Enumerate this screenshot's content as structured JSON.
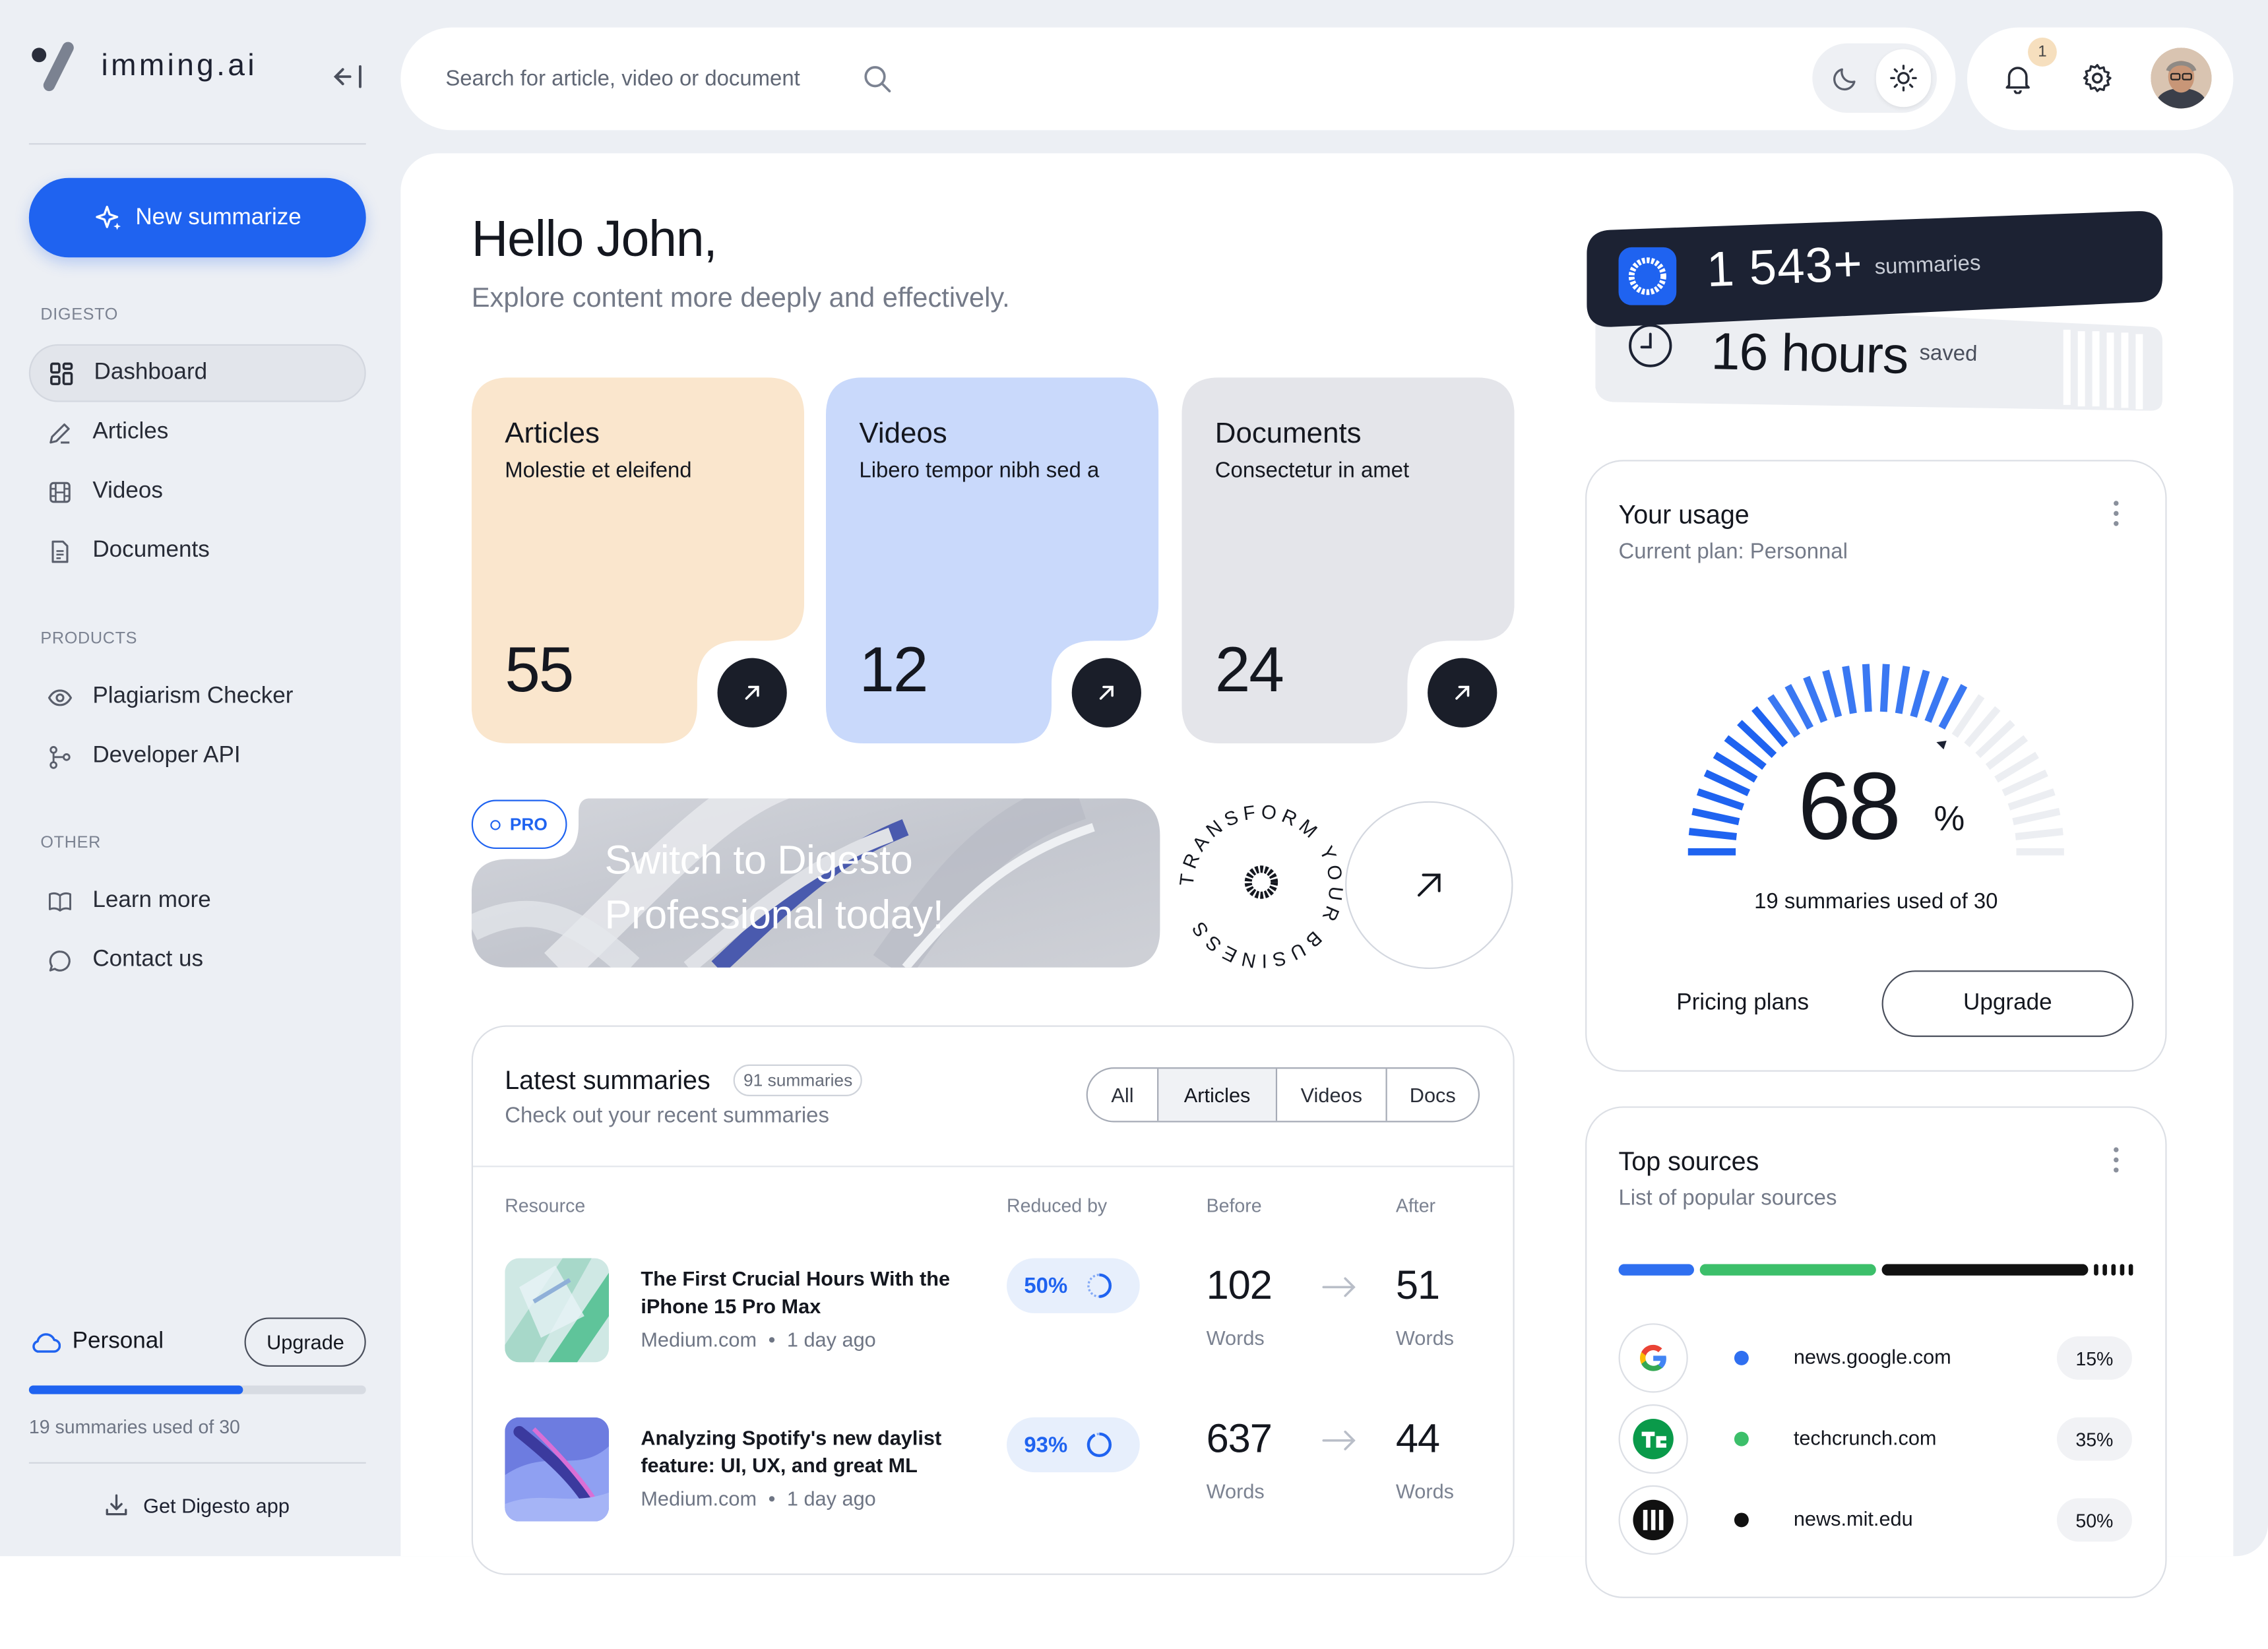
{
  "app": {
    "logo_text": "imming.ai"
  },
  "sidebar": {
    "new_button": "New summarize",
    "sections": [
      {
        "label": "DIGESTO",
        "items": [
          {
            "label": "Dashboard",
            "icon": "grid-icon",
            "active": true
          },
          {
            "label": "Articles",
            "icon": "pen-icon"
          },
          {
            "label": "Videos",
            "icon": "film-icon"
          },
          {
            "label": "Documents",
            "icon": "document-icon"
          }
        ]
      },
      {
        "label": "PRODUCTS",
        "items": [
          {
            "label": "Plagiarism Checker",
            "icon": "eye-icon"
          },
          {
            "label": "Developer API",
            "icon": "branch-icon"
          }
        ]
      },
      {
        "label": "OTHER",
        "items": [
          {
            "label": "Learn more",
            "icon": "book-icon"
          },
          {
            "label": "Contact us",
            "icon": "chat-icon"
          }
        ]
      }
    ],
    "plan": {
      "name": "Personal",
      "upgrade": "Upgrade",
      "usage_text": "19 summaries used of 30",
      "used": 19,
      "total": 30
    },
    "get_app": "Get Digesto app"
  },
  "header": {
    "search_placeholder": "Search for article, video or document",
    "notification_count": "1"
  },
  "greeting": {
    "title": "Hello John,",
    "subtitle": "Explore content more deeply and effectively."
  },
  "cards": [
    {
      "title": "Articles",
      "subtitle": "Molestie et eleifend",
      "count": "55",
      "color": "#fae6cd"
    },
    {
      "title": "Videos",
      "subtitle": "Libero tempor nibh sed a",
      "count": "12",
      "color": "#c9d9fb"
    },
    {
      "title": "Documents",
      "subtitle": "Consectetur in amet",
      "count": "24",
      "color": "#e4e5ea"
    }
  ],
  "promo": {
    "badge": "PRO",
    "line1": "Switch to Digesto",
    "line2": "Professional today!",
    "circle_text": "TRANSFORM YOUR BUSINESS"
  },
  "latest": {
    "title": "Latest summaries",
    "count": "91 summaries",
    "subtitle": "Check out your recent summaries",
    "tabs": [
      "All",
      "Articles",
      "Videos",
      "Docs"
    ],
    "selected_tab": "Articles",
    "columns": {
      "resource": "Resource",
      "reduced": "Reduced by",
      "before": "Before",
      "after": "After"
    },
    "rows": [
      {
        "title": "The First Crucial Hours With the iPhone 15 Pro Max",
        "source": "Medium.com",
        "time": "1 day ago",
        "reduced": "50%",
        "before": "102",
        "after": "51",
        "unit": "Words"
      },
      {
        "title": "Analyzing Spotify's new daylist feature: UI, UX, and great ML",
        "source": "Medium.com",
        "time": "1 day ago",
        "reduced": "93%",
        "before": "637",
        "after": "44",
        "unit": "Words"
      }
    ]
  },
  "stats": {
    "summaries_value": "1 543+",
    "summaries_label": "summaries",
    "hours_value": "16 hours",
    "hours_label": "saved"
  },
  "usage": {
    "title": "Your usage",
    "subtitle": "Current plan: Personnal",
    "percent": "68",
    "percent_sign": "%",
    "used_text": "19 summaries used of 30",
    "pricing": "Pricing plans",
    "upgrade": "Upgrade"
  },
  "sources": {
    "title": "Top sources",
    "subtitle": "List of popular sources",
    "items": [
      {
        "name": "news.google.com",
        "pct": "15%",
        "color": "#2f6ff0",
        "icon": "google-icon"
      },
      {
        "name": "techcrunch.com",
        "pct": "35%",
        "color": "#3cbf6a",
        "icon": "techcrunch-icon"
      },
      {
        "name": "news.mit.edu",
        "pct": "50%",
        "color": "#111111",
        "icon": "mit-icon"
      }
    ]
  }
}
